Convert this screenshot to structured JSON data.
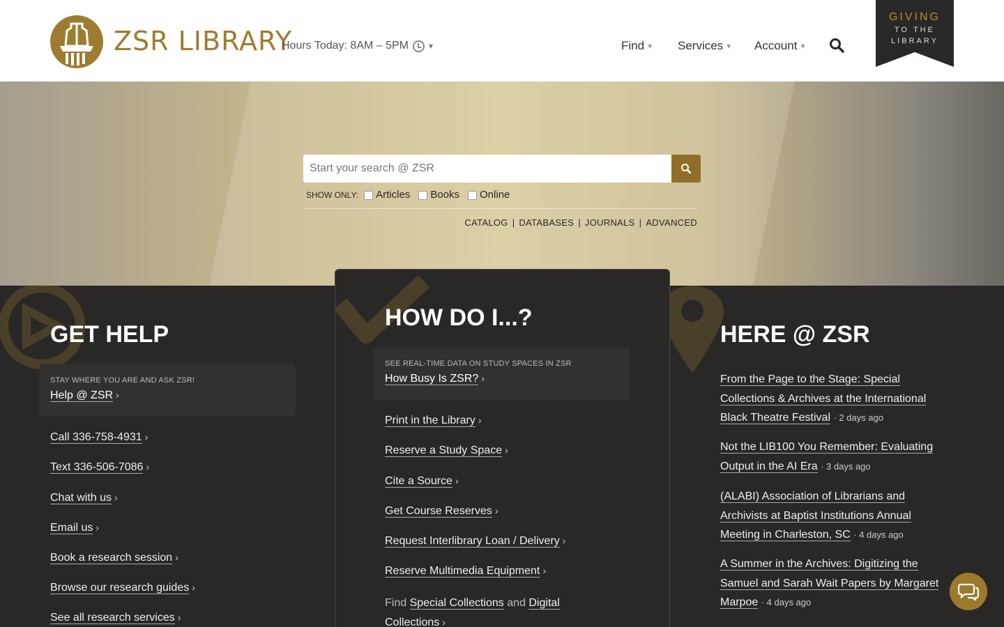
{
  "header": {
    "brand": "ZSR LIBRARY",
    "hours": "Hours Today: 8AM – 5PM",
    "caret": "▾",
    "nav": [
      {
        "label": "Find"
      },
      {
        "label": "Services"
      },
      {
        "label": "Account"
      }
    ],
    "giving": {
      "line1": "GIVING",
      "line2": "TO THE",
      "line3": "LIBRARY"
    }
  },
  "search": {
    "placeholder": "Start your search @ ZSR",
    "show_only_label": "SHOW ONLY:",
    "filters": [
      "Articles",
      "Books",
      "Online"
    ],
    "links": [
      "CATALOG",
      "DATABASES",
      "JOURNALS",
      "ADVANCED"
    ],
    "separator": "|"
  },
  "get_help": {
    "title": "GET HELP",
    "card_small": "STAY WHERE YOU ARE AND ASK ZSR!",
    "card_link": "Help @ ZSR",
    "items": [
      "Call 336-758-4931",
      "Text 336-506-7086",
      "Chat with us",
      "Email us",
      "Book a research session",
      "Browse our research guides",
      "See all research services"
    ]
  },
  "how_do_i": {
    "title": "HOW DO I...?",
    "card_small": "SEE REAL-TIME DATA ON STUDY SPACES IN ZSR",
    "card_link": "How Busy Is ZSR?",
    "items": [
      "Print in the Library",
      "Reserve a Study Space",
      "Cite a Source",
      "Get Course Reserves",
      "Request Interlibrary Loan / Delivery",
      "Reserve Multimedia Equipment"
    ],
    "last": {
      "prefix": "Find",
      "link1": "Special Collections",
      "mid": "and",
      "link2a": "Digital",
      "link2b": "Collections"
    }
  },
  "here_at_zsr": {
    "title": "HERE @ ZSR",
    "news": [
      {
        "lines": [
          "From the Page to the Stage: Special",
          "Collections & Archives at the International",
          "Black Theatre Festival"
        ],
        "ago": "· 2 days ago"
      },
      {
        "lines": [
          "Not the LIB100 You Remember: Evaluating",
          "Output in the AI Era"
        ],
        "ago": "· 3 days ago"
      },
      {
        "lines": [
          "(ALABI) Association of Librarians and",
          "Archivists at Baptist Institutions Annual",
          "Meeting in Charleston, SC"
        ],
        "ago": "· 4 days ago"
      },
      {
        "lines": [
          "A Summer in the Archives: Digitizing the",
          "Samuel and Sarah Wait Papers by Margaret",
          "Marpoe"
        ],
        "ago": "· 4 days ago"
      }
    ]
  },
  "arrow": "›",
  "colors": {
    "gold": "#9e7c2f",
    "dark": "#2a2827"
  }
}
